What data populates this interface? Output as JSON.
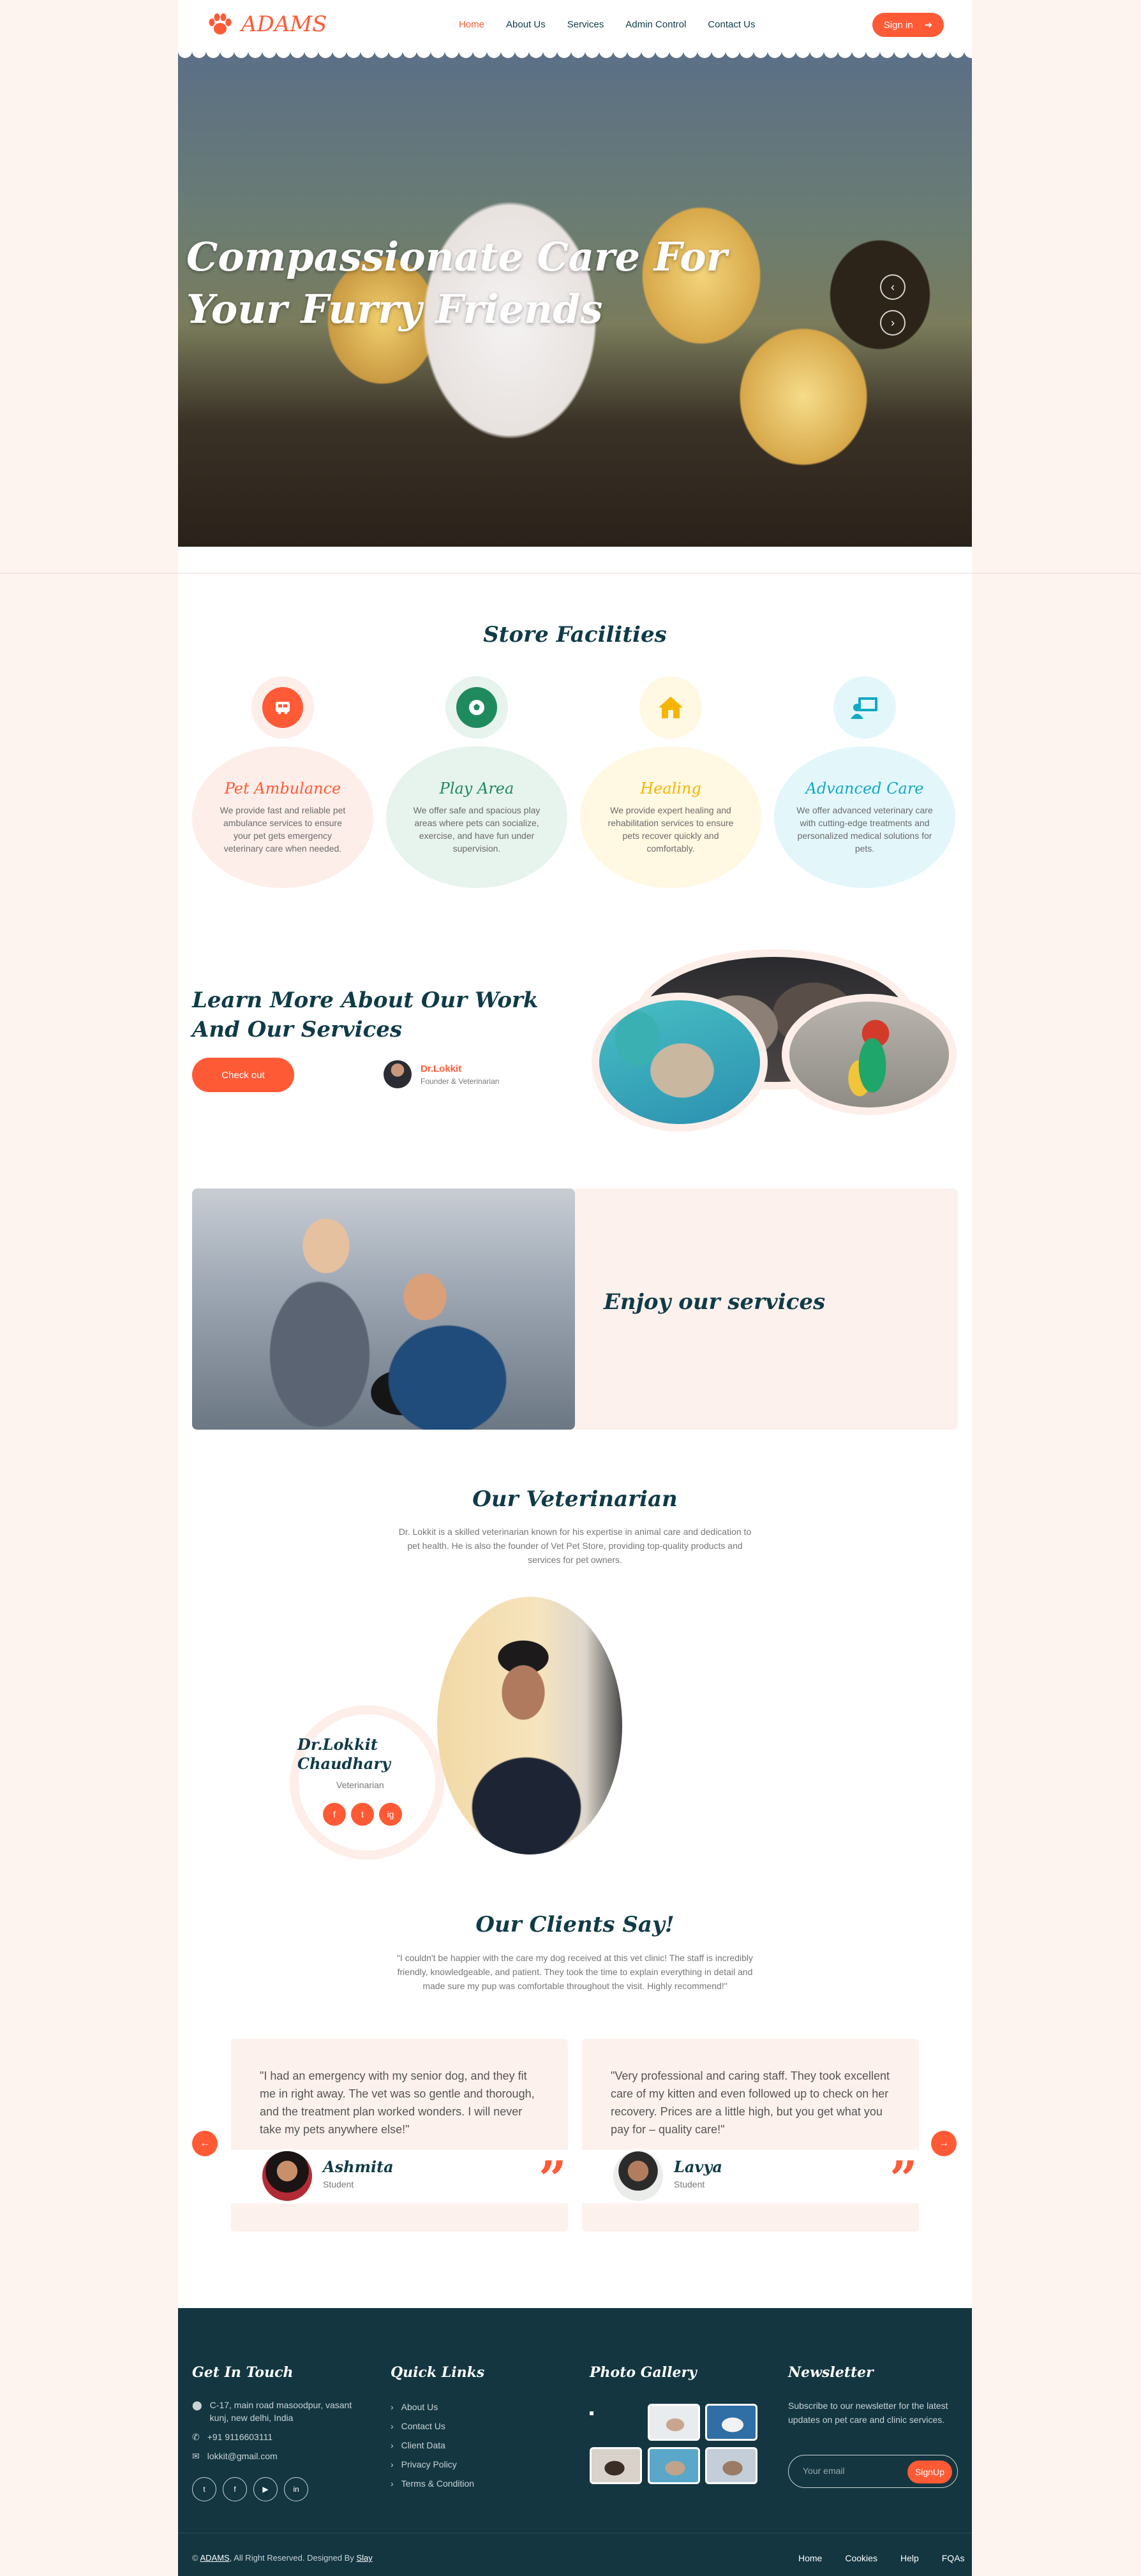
{
  "brand": {
    "name": "ADAMS",
    "accent": "#ff5a36",
    "dark": "#0f3b47"
  },
  "nav": {
    "items": [
      "Home",
      "About Us",
      "Services",
      "Admin Control",
      "Contact Us"
    ],
    "active": "Home",
    "signin": "Sign in"
  },
  "hero": {
    "title": "Compassionate Care For Your Furry Friends"
  },
  "facilities": {
    "title": "Store Facilities",
    "items": [
      {
        "title": "Pet Ambulance",
        "text": "We provide fast and reliable pet ambulance services to ensure your pet gets emergency veterinary care when needed.",
        "icon": "ambulance-icon",
        "color": "#ff5a36"
      },
      {
        "title": "Play Area",
        "text": "We offer safe and spacious play areas where pets can socialize, exercise, and have fun under supervision.",
        "icon": "ball-icon",
        "color": "#1f8a5e"
      },
      {
        "title": "Healing",
        "text": "We provide expert healing and rehabilitation services to ensure pets recover quickly and comfortably.",
        "icon": "home-icon",
        "color": "#f5b400"
      },
      {
        "title": "Advanced Care",
        "text": "We offer advanced veterinary care with cutting-edge treatments and personalized medical solutions for pets.",
        "icon": "monitor-user-icon",
        "color": "#12a9c4"
      }
    ]
  },
  "about": {
    "title": "Learn More About Our Work And Our Services",
    "button": "Check out",
    "founder_name": "Dr.Lokkit",
    "founder_role": "Founder & Veterinarian"
  },
  "enjoy": {
    "title": "Enjoy our services"
  },
  "vet": {
    "title": "Our Veterinarian",
    "text": "Dr. Lokkit is a skilled veterinarian known for his expertise in animal care and dedication to pet health. He is also the founder of Vet Pet Store, providing top-quality products and services for pet owners.",
    "name": "Dr.Lokkit Chaudhary",
    "role": "Veterinarian",
    "social": [
      "f",
      "t",
      "ig"
    ]
  },
  "clients": {
    "title": "Our Clients Say!",
    "text": "\"I couldn't be happier with the care my dog received at this vet clinic! The staff is incredibly friendly, knowledgeable, and patient. They took the time to explain everything in detail and made sure my pup was comfortable throughout the visit. Highly recommend!\"",
    "testimonials": [
      {
        "text": "\"I had an emergency with my senior dog, and they fit me in right away. The vet was so gentle and thorough, and the treatment plan worked wonders. I will never take my pets anywhere else!\"",
        "name": "Ashmita",
        "role": "Student"
      },
      {
        "text": "\"Very professional and caring staff. They took excellent care of my kitten and even followed up to check on her recovery. Prices are a little high, but you get what you pay for – quality care!\"",
        "name": "Lavya",
        "role": "Student"
      }
    ]
  },
  "footer": {
    "contact_title": "Get In Touch",
    "address": "C-17, main road masoodpur, vasant kunj, new delhi, India",
    "phone": "+91 9116603111",
    "email": "lokkit@gmail.com",
    "quick_title": "Quick Links",
    "quick_links": [
      "About Us",
      "Contact Us",
      "Client Data",
      "Privacy Policy",
      "Terms & Condition"
    ],
    "gallery_title": "Photo Gallery",
    "newsletter_title": "Newsletter",
    "newsletter_text": "Subscribe to our newsletter for the latest updates on pet care and clinic services.",
    "newsletter_placeholder": "Your email",
    "newsletter_button": "SignUp",
    "copy_prefix": "©",
    "copy_brand": "ADAMS",
    "copy_mid": ", All Right Reserved. Designed By",
    "copy_designer": "Slay",
    "bottom_links": [
      "Home",
      "Cookies",
      "Help",
      "FQAs"
    ]
  }
}
